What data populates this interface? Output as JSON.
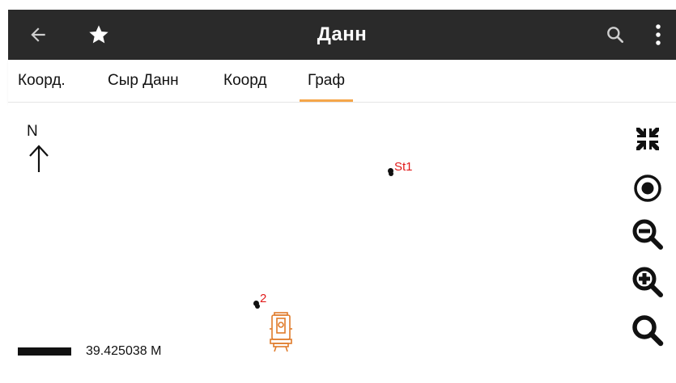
{
  "toolbar": {
    "title": "Данн",
    "back_icon": "arrow-back-icon",
    "favorite_icon": "star-icon",
    "search_icon": "search-icon",
    "menu_icon": "more-vertical-icon",
    "background": "#2a2a2a"
  },
  "tabs": [
    {
      "label": "Коорд.",
      "active": false
    },
    {
      "label": "Сыр Данн",
      "active": false
    },
    {
      "label": "Коорд",
      "active": false
    },
    {
      "label": "Граф",
      "active": true
    }
  ],
  "map": {
    "north_label": "N",
    "points": [
      {
        "label": "St1"
      },
      {
        "label": "2"
      }
    ],
    "scale_text": "39.425038 M",
    "instrument_icon": "total-station-icon",
    "controls": [
      {
        "icon": "fit-extent-icon"
      },
      {
        "icon": "locate-icon"
      },
      {
        "icon": "zoom-out-icon"
      },
      {
        "icon": "zoom-in-icon"
      },
      {
        "icon": "search-map-icon"
      }
    ],
    "accent_color": "#f5a64a",
    "point_label_color": "#e11a1a"
  }
}
